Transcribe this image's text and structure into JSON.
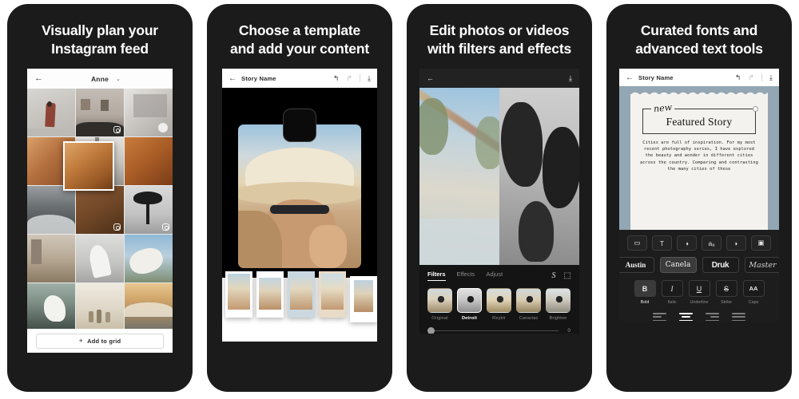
{
  "panels": [
    {
      "headline_lines": [
        "Visually plan your",
        "Instagram feed"
      ],
      "screen": {
        "back_icon": "←",
        "title": "Anne",
        "chevron_icon": "⌄",
        "add_button_label": "Add to grid",
        "add_button_plus": "+",
        "grid_badge_icon": "instagram-badge"
      }
    },
    {
      "headline_lines": [
        "Choose a template",
        "and add your content"
      ],
      "screen": {
        "back_icon": "←",
        "title": "Story Name",
        "undo_icon": "↰",
        "redo_icon": "↱",
        "download_icon": "⤓",
        "template_count": 5
      }
    },
    {
      "headline_lines": [
        "Edit photos or videos",
        "with filters and effects"
      ],
      "screen": {
        "back_icon": "←",
        "download_icon": "⤓",
        "tabs": [
          {
            "label": "Filters",
            "active": true
          },
          {
            "label": "Effects",
            "active": false
          },
          {
            "label": "Adjust",
            "active": false
          }
        ],
        "magic_icon": "S",
        "crop_icon": "⬚",
        "filters": [
          {
            "name": "Original",
            "selected": false
          },
          {
            "name": "Detroit",
            "selected": true
          },
          {
            "name": "Reykir",
            "selected": false
          },
          {
            "name": "Canarias",
            "selected": false
          },
          {
            "name": "Brighton",
            "selected": false
          }
        ],
        "slider_value": "0"
      }
    },
    {
      "headline_lines": [
        "Curated fonts and",
        "advanced text tools"
      ],
      "screen": {
        "back_icon": "←",
        "title": "Story Name",
        "undo_icon": "↰",
        "redo_icon": "↱",
        "download_icon": "⤓",
        "card": {
          "eyebrow": "new",
          "title": "Featured Story",
          "body": "Cities are full of inspiration. For my most recent photography series, I have explored the beauty and wonder in different cities across the country. Comparing and contrasting the many cities of these"
        },
        "tool_icons": [
          {
            "name": "keyboard-icon",
            "glyph": "▭"
          },
          {
            "name": "text-icon",
            "glyph": "T"
          },
          {
            "name": "color-icon",
            "glyph": "◑"
          },
          {
            "name": "font-size-icon",
            "glyph": "aₐ"
          },
          {
            "name": "opacity-icon",
            "glyph": "◗"
          },
          {
            "name": "image-icon",
            "glyph": "▣"
          }
        ],
        "fonts": [
          {
            "label": "Austin",
            "selected": false
          },
          {
            "label": "Canela",
            "selected": true
          },
          {
            "label": "Druk",
            "selected": false
          },
          {
            "label": "Master",
            "selected": false
          }
        ],
        "text_styles": [
          {
            "glyph": "B",
            "label": "Bold",
            "selected": true
          },
          {
            "glyph": "I",
            "label": "Italic",
            "selected": false
          },
          {
            "glyph": "U",
            "label": "Underline",
            "selected": false
          },
          {
            "glyph": "S",
            "label": "Strike",
            "selected": false
          },
          {
            "glyph": "AA",
            "label": "Caps",
            "selected": false
          }
        ],
        "alignments": [
          {
            "name": "align-left",
            "selected": false
          },
          {
            "name": "align-center",
            "selected": true
          },
          {
            "name": "align-right",
            "selected": false
          },
          {
            "name": "align-justify",
            "selected": false
          }
        ]
      }
    }
  ],
  "colors": {
    "device_bg": "#1b1b1b",
    "page_bg": "#ffffff",
    "accent_text": "#ffffff"
  }
}
